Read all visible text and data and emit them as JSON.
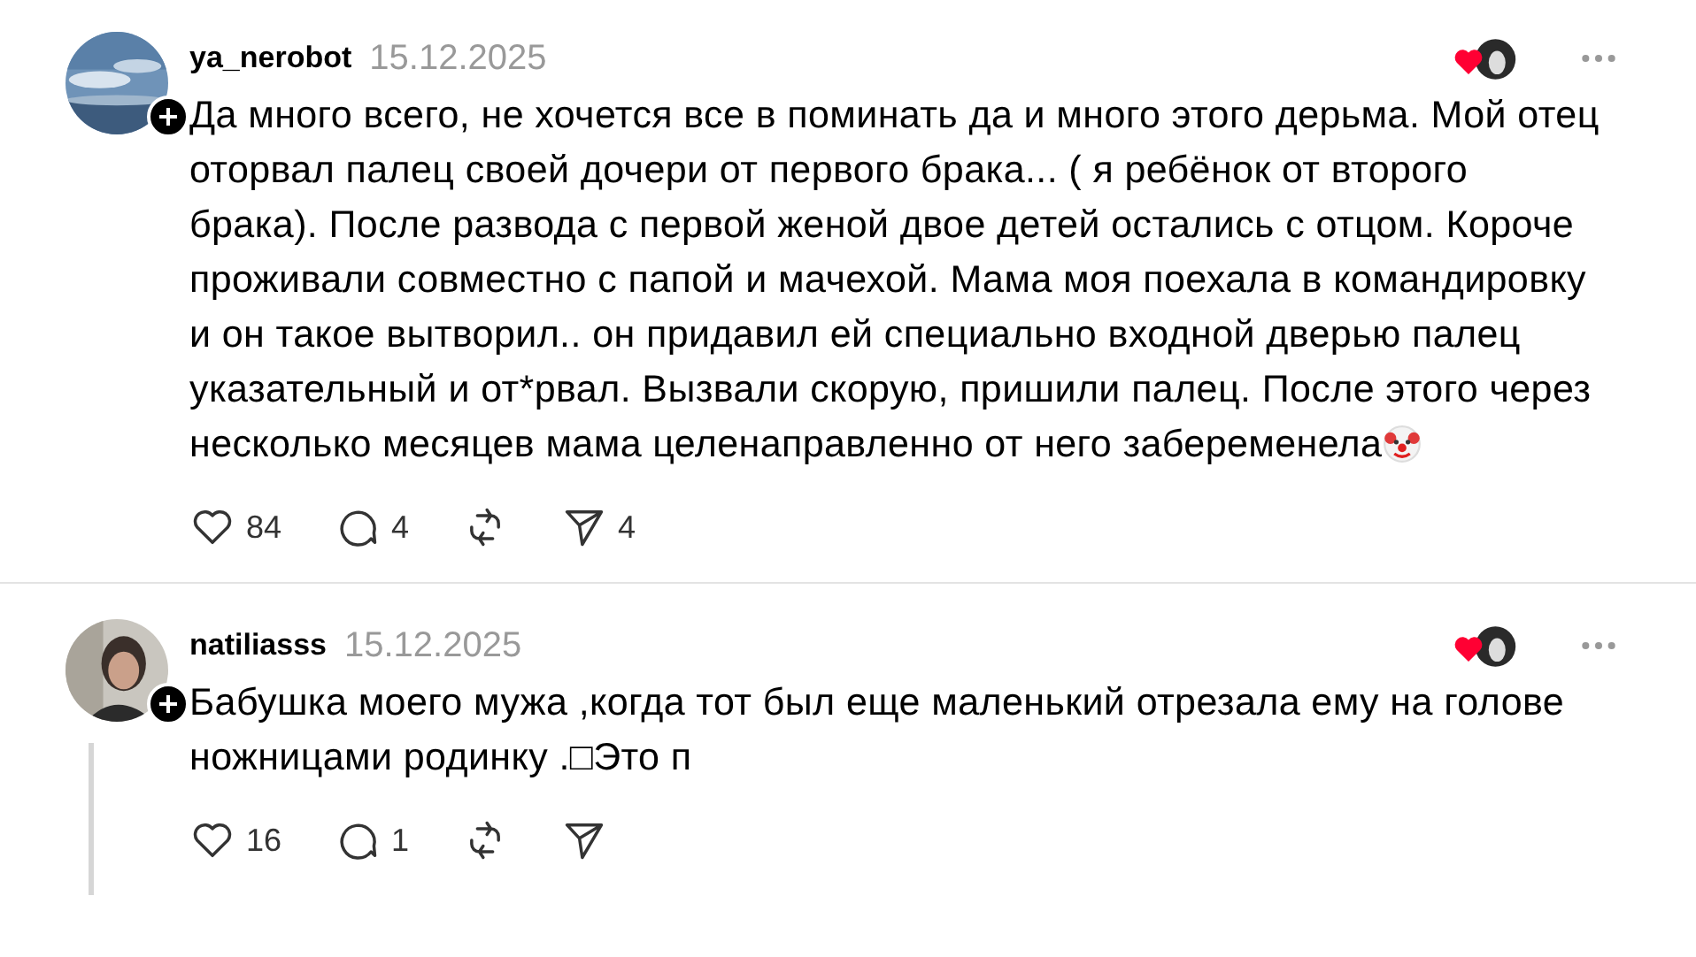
{
  "comments": [
    {
      "username": "ya_nerobot",
      "date": "15.12.2025",
      "text": "Да много всего, не хочется все в поминать да и много этого дерьма. Мой отец оторвал палец своей дочери от первого брака... ( я ребёнок от второго брака). После развода с первой женой двое детей остались с отцом. Короче проживали совместно с папой и мачехой. Мама моя поехала в командировку и он такое вытворил.. он придавил ей специально входной дверью палец указательный и от*рвал. Вызвали скорую, пришили палец. После этого через несколько месяцев мама целенаправленно от него забеременела",
      "ends_with_clown": true,
      "thread_line": false,
      "likes": "84",
      "replies": "4",
      "shares": "4"
    },
    {
      "username": "natiliasss",
      "date": "15.12.2025",
      "text": "Бабушка моего мужа ,когда тот был еще маленький отрезала ему на голове ножницами родинку .□Это п",
      "ends_with_clown": false,
      "thread_line": true,
      "likes": "16",
      "replies": "1"
    }
  ]
}
